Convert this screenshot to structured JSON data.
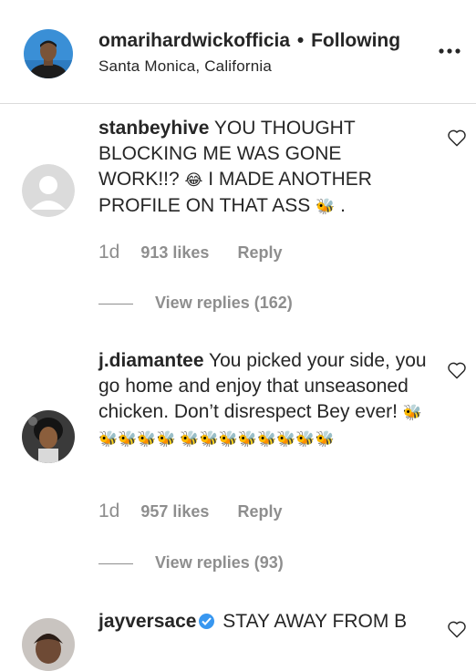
{
  "header": {
    "username": "omarihardwickofficia",
    "separator": "•",
    "follow_status": "Following",
    "location": "Santa Monica, California"
  },
  "comments": [
    {
      "username": "stanbeyhive",
      "text_part1": "YOU THOUGHT BLOCKING ME WAS GONE WORK!!?",
      "emoji1": "😂",
      "text_part2": "I MADE ANOTHER PROFILE ON THAT ASS",
      "emoji2": "🐝",
      "text_part3": ".",
      "age": "1d",
      "likes": "913 likes",
      "reply_label": "Reply",
      "view_replies": "View replies (162)"
    },
    {
      "username": "j.diamantee",
      "text": "You picked your side, you go home and enjoy that unseasoned chicken. Don’t disrespect Bey ever!",
      "emojis": "🐝🐝🐝🐝🐝 🐝🐝🐝🐝🐝🐝🐝🐝",
      "age": "1d",
      "likes": "957 likes",
      "reply_label": "Reply",
      "view_replies": "View replies (93)"
    },
    {
      "username": "jayversace",
      "text": "STAY AWAY FROM B"
    }
  ],
  "colors": {
    "text": "#262626",
    "muted": "#8e8e8e",
    "divider": "#dbdbdb",
    "verified": "#3897f0"
  },
  "icons": [
    "more-options-icon",
    "heart-icon",
    "verified-badge-icon"
  ]
}
